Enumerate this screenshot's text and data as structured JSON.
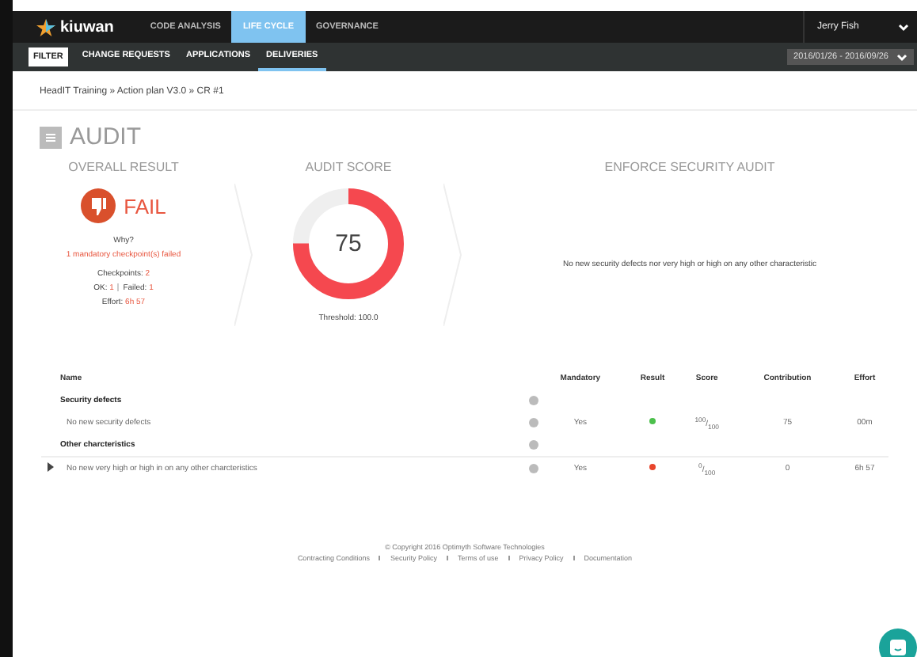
{
  "topnav": {
    "logo": "kiuwan",
    "tabs": [
      {
        "label": "CODE ANALYSIS",
        "selected": false
      },
      {
        "label": "LIFE CYCLE",
        "selected": true
      },
      {
        "label": "GOVERNANCE",
        "selected": false
      }
    ],
    "user": "Jerry Fish"
  },
  "subnav": {
    "filter": "FILTER",
    "tabs": [
      {
        "label": "CHANGE REQUESTS",
        "selected": false
      },
      {
        "label": "APPLICATIONS",
        "selected": false
      },
      {
        "label": "DELIVERIES",
        "selected": true
      }
    ],
    "date_range": "2016/01/26 - 2016/09/26"
  },
  "breadcrumb": "HeadIT Training » Action plan V3.0 » CR #1",
  "title": "AUDIT",
  "overall": {
    "heading": "OVERALL RESULT",
    "result": "FAIL",
    "why": "Why?",
    "reason": "1 mandatory checkpoint(s) failed",
    "checkpoints_label": "Checkpoints:",
    "checkpoints": "2",
    "ok_label": "OK:",
    "ok": "1",
    "failed_label": "Failed:",
    "failed": "1",
    "effort_label": "Effort:",
    "effort": "6h 57"
  },
  "score": {
    "heading": "AUDIT SCORE",
    "value": "75",
    "level": 0.75,
    "threshold": "Threshold: 100.0"
  },
  "enforce": {
    "heading": "ENFORCE SECURITY AUDIT",
    "text": "No new security defects nor very high or high on any other characteristic"
  },
  "table": {
    "columns": [
      "Name",
      "Mandatory",
      "Result",
      "Score",
      "Contribution",
      "Effort"
    ],
    "rows": [
      {
        "kind": "group",
        "name": "Security defects"
      },
      {
        "kind": "item",
        "name": "No new security defects",
        "expandable": false,
        "mandatory": "Yes",
        "color": "#4cc04c",
        "score": "$^{100}$/$_{100}$",
        "contribution": "75",
        "effort": "00m"
      },
      {
        "kind": "group",
        "name": "Other charcteristics"
      },
      {
        "kind": "item",
        "name": "No new very high or high in on any other charcteristics",
        "expandable": true,
        "mandatory": "Yes",
        "color": "#e8452c",
        "score": "$^{0}$/$_{100}$",
        "contribution": "0",
        "effort": "6h 57"
      }
    ]
  },
  "footer": {
    "copyright": "© Copyright 2016 Optimyth Software Technologies",
    "links": [
      "Contracting Conditions",
      "Security Policy",
      "Terms of use",
      "Privacy Policy",
      "Documentation"
    ]
  }
}
